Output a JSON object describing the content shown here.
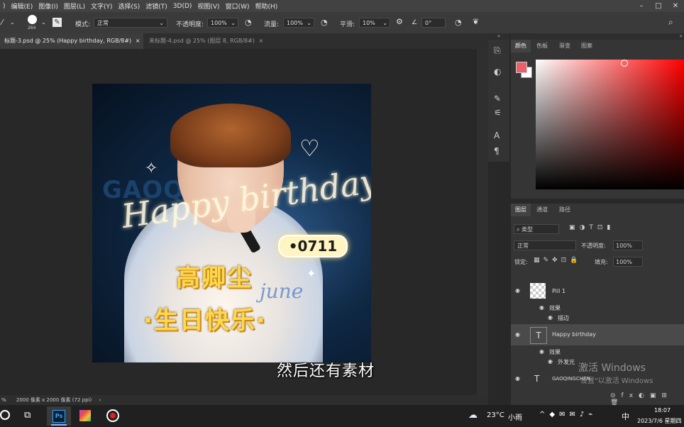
{
  "menu": {
    "items": [
      "编辑(E)",
      "图像(I)",
      "图层(L)",
      "文字(Y)",
      "选择(S)",
      "滤镜(T)",
      "3D(D)",
      "视图(V)",
      "窗口(W)",
      "帮助(H)"
    ],
    "window_controls": [
      "–",
      "□",
      "✕"
    ]
  },
  "options": {
    "brush_size": "264",
    "mode_label": "模式:",
    "mode_value": "正常",
    "opacity_label": "不透明度:",
    "opacity_value": "100%",
    "flow_label": "流量:",
    "flow_value": "100%",
    "smooth_label": "平滑:",
    "smooth_value": "10%",
    "angle_value": "0°"
  },
  "tabs": [
    {
      "label": "标题-3.psd @ 25% (Happy birthday, RGB/8#)",
      "active": true
    },
    {
      "label": "未标题-4.psd @ 25% (图层 8, RGB/8#)",
      "active": false
    }
  ],
  "artwork": {
    "script_text": "Happy birthday",
    "bg_text": "GAOQINGCHEN",
    "date_badge": "•0711",
    "name": "高卿尘",
    "greeting": "·生日快乐·",
    "faint_text": "june"
  },
  "color_panel": {
    "tabs": [
      "颜色",
      "色板",
      "渐变",
      "图案"
    ],
    "fg_color": "#e8606a",
    "bg_color": "#ffffff",
    "hue_color": "#ff0000"
  },
  "layers_panel": {
    "tabs": [
      "图层",
      "通道",
      "路径"
    ],
    "filter_label": "类型",
    "blend_mode": "正常",
    "opacity_label": "不透明度:",
    "opacity_value": "100%",
    "lock_label": "锁定:",
    "fill_label": "填充:",
    "fill_value": "100%",
    "layers": [
      {
        "name": "Pill 1",
        "type": "image"
      },
      {
        "name": "效果",
        "type": "effects"
      },
      {
        "name": "描边",
        "type": "effect"
      },
      {
        "name": "Happy birthday",
        "type": "text"
      },
      {
        "name": "效果",
        "type": "effects"
      },
      {
        "name": "外发光",
        "type": "effect"
      },
      {
        "name": "GAOQINGCHEN",
        "type": "text"
      }
    ]
  },
  "status": {
    "zoom": "%",
    "doc_info": "2000 像素 x 2000 像素 (72 ppi)"
  },
  "subtitle": "然后还有素材",
  "watermark": {
    "line1": "激活 Windows",
    "line2": "设置\"以激活 Windows"
  },
  "taskbar": {
    "weather_temp": "23°C",
    "weather_desc": "小雨",
    "ime": "中",
    "time": "18:07",
    "date": "2023/7/6 星期四"
  }
}
